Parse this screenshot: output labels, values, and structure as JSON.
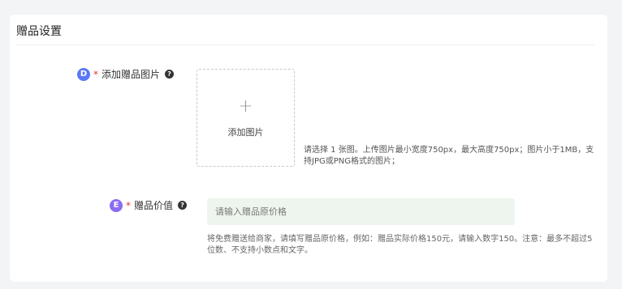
{
  "section": {
    "title": "赠品设置"
  },
  "image_field": {
    "badge": "D",
    "required_mark": "*",
    "label": "添加赠品图片",
    "help_glyph": "?",
    "upload_icon": "+",
    "upload_text": "添加图片",
    "hint": "请选择 1 张图。上传图片最小宽度750px，最大高度750px；图片小于1MB，支持JPG或PNG格式的图片；"
  },
  "price_field": {
    "badge": "E",
    "required_mark": "*",
    "label": "赠品价值",
    "help_glyph": "?",
    "placeholder": "请输入赠品原价格",
    "value": "",
    "hint": "将免费赠送给商家，请填写赠品原价格，例如：赠品实际价格150元，请输入数字150。注意：最多不超过5位数、不支持小数点和文字。"
  },
  "colors": {
    "badge_d": "#5b78f6",
    "badge_e": "#8a6cf2",
    "required": "#e53935",
    "input_bg": "#eef5ee"
  }
}
